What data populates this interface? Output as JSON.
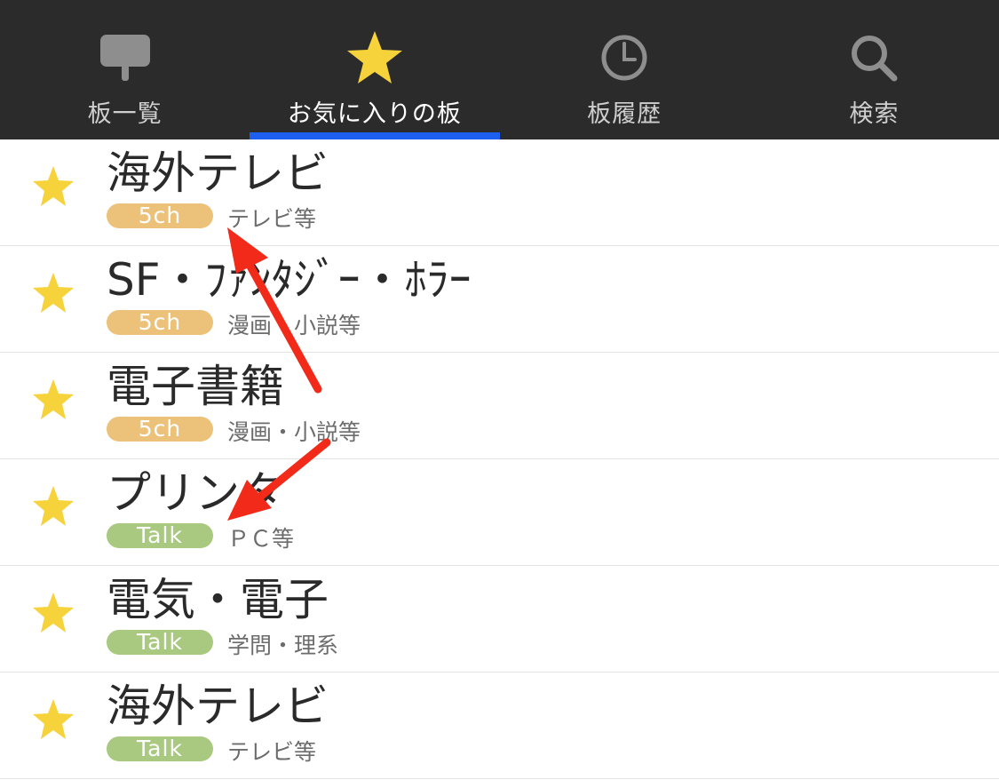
{
  "tabs": [
    {
      "label": "板一覧",
      "icon": "signboard-icon",
      "active": false
    },
    {
      "label": "お気に入りの板",
      "icon": "star-icon",
      "active": true
    },
    {
      "label": "板履歴",
      "icon": "clock-icon",
      "active": false
    },
    {
      "label": "検索",
      "icon": "search-icon",
      "active": false
    }
  ],
  "boards": [
    {
      "title": "海外テレビ",
      "badge": "5ch",
      "category": "テレビ等"
    },
    {
      "title": "SF・ﾌｧﾝﾀｼﾞｰ・ﾎﾗｰ",
      "badge": "5ch",
      "category": "漫画・小説等"
    },
    {
      "title": "電子書籍",
      "badge": "5ch",
      "category": "漫画・小説等"
    },
    {
      "title": "プリンタ",
      "badge": "Talk",
      "category": "ＰＣ等"
    },
    {
      "title": "電気・電子",
      "badge": "Talk",
      "category": "学問・理系"
    },
    {
      "title": "海外テレビ",
      "badge": "Talk",
      "category": "テレビ等"
    }
  ],
  "colors": {
    "tabbar_bg": "#2b2b2b",
    "active_indicator": "#1d5ff0",
    "star": "#f7d33b",
    "badge_5ch": "#ecc27a",
    "badge_talk": "#a8c97f",
    "annotation_arrow": "#f22a1a"
  }
}
